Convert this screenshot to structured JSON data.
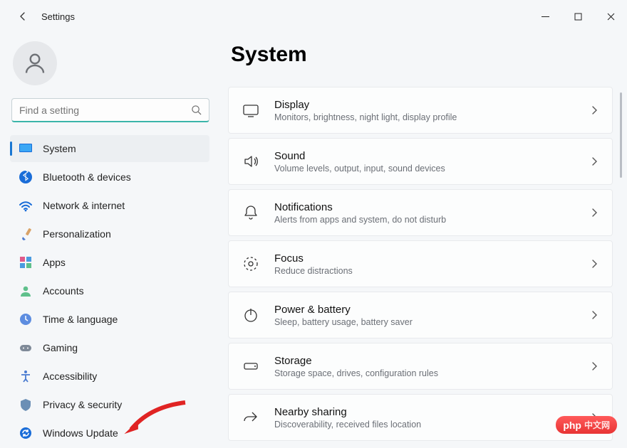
{
  "window": {
    "title": "Settings"
  },
  "search": {
    "placeholder": "Find a setting"
  },
  "sidebar": {
    "items": [
      {
        "label": "System",
        "selected": true,
        "icon": "system"
      },
      {
        "label": "Bluetooth & devices",
        "icon": "bluetooth"
      },
      {
        "label": "Network & internet",
        "icon": "wifi"
      },
      {
        "label": "Personalization",
        "icon": "brush"
      },
      {
        "label": "Apps",
        "icon": "apps"
      },
      {
        "label": "Accounts",
        "icon": "person"
      },
      {
        "label": "Time & language",
        "icon": "clock"
      },
      {
        "label": "Gaming",
        "icon": "game"
      },
      {
        "label": "Accessibility",
        "icon": "access"
      },
      {
        "label": "Privacy & security",
        "icon": "shield"
      },
      {
        "label": "Windows Update",
        "icon": "update"
      }
    ]
  },
  "page": {
    "title": "System",
    "items": [
      {
        "title": "Display",
        "sub": "Monitors, brightness, night light, display profile",
        "icon": "display"
      },
      {
        "title": "Sound",
        "sub": "Volume levels, output, input, sound devices",
        "icon": "sound"
      },
      {
        "title": "Notifications",
        "sub": "Alerts from apps and system, do not disturb",
        "icon": "bell"
      },
      {
        "title": "Focus",
        "sub": "Reduce distractions",
        "icon": "focus"
      },
      {
        "title": "Power & battery",
        "sub": "Sleep, battery usage, battery saver",
        "icon": "power"
      },
      {
        "title": "Storage",
        "sub": "Storage space, drives, configuration rules",
        "icon": "storage"
      },
      {
        "title": "Nearby sharing",
        "sub": "Discoverability, received files location",
        "icon": "share"
      }
    ]
  },
  "badge": {
    "brand": "php",
    "cn": "中文网"
  }
}
